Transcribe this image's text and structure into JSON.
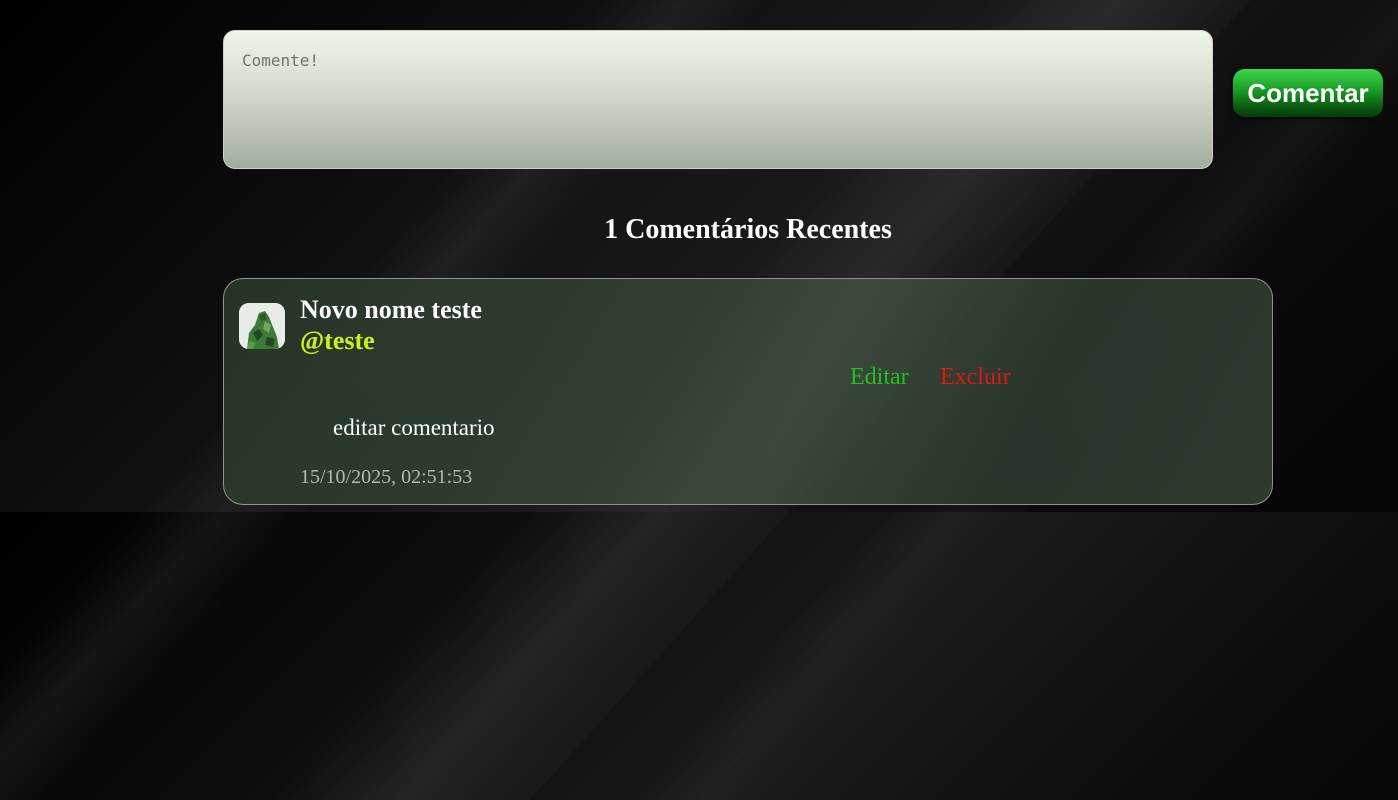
{
  "composer": {
    "placeholder": "Comente!",
    "value": "",
    "submit_label": "Comentar"
  },
  "comments_section": {
    "title": "1 Comentários Recentes"
  },
  "comments": [
    {
      "author_name": "Novo nome teste",
      "author_handle": "@teste",
      "edit_label": "Editar",
      "delete_label": "Excluir",
      "text": "editar comentario",
      "date": "15/10/2025, 02:51:53"
    }
  ],
  "colors": {
    "handle": "#c8f21c",
    "edit": "#1fc21f",
    "delete": "#e01818",
    "button_green": "#1a9a25"
  }
}
